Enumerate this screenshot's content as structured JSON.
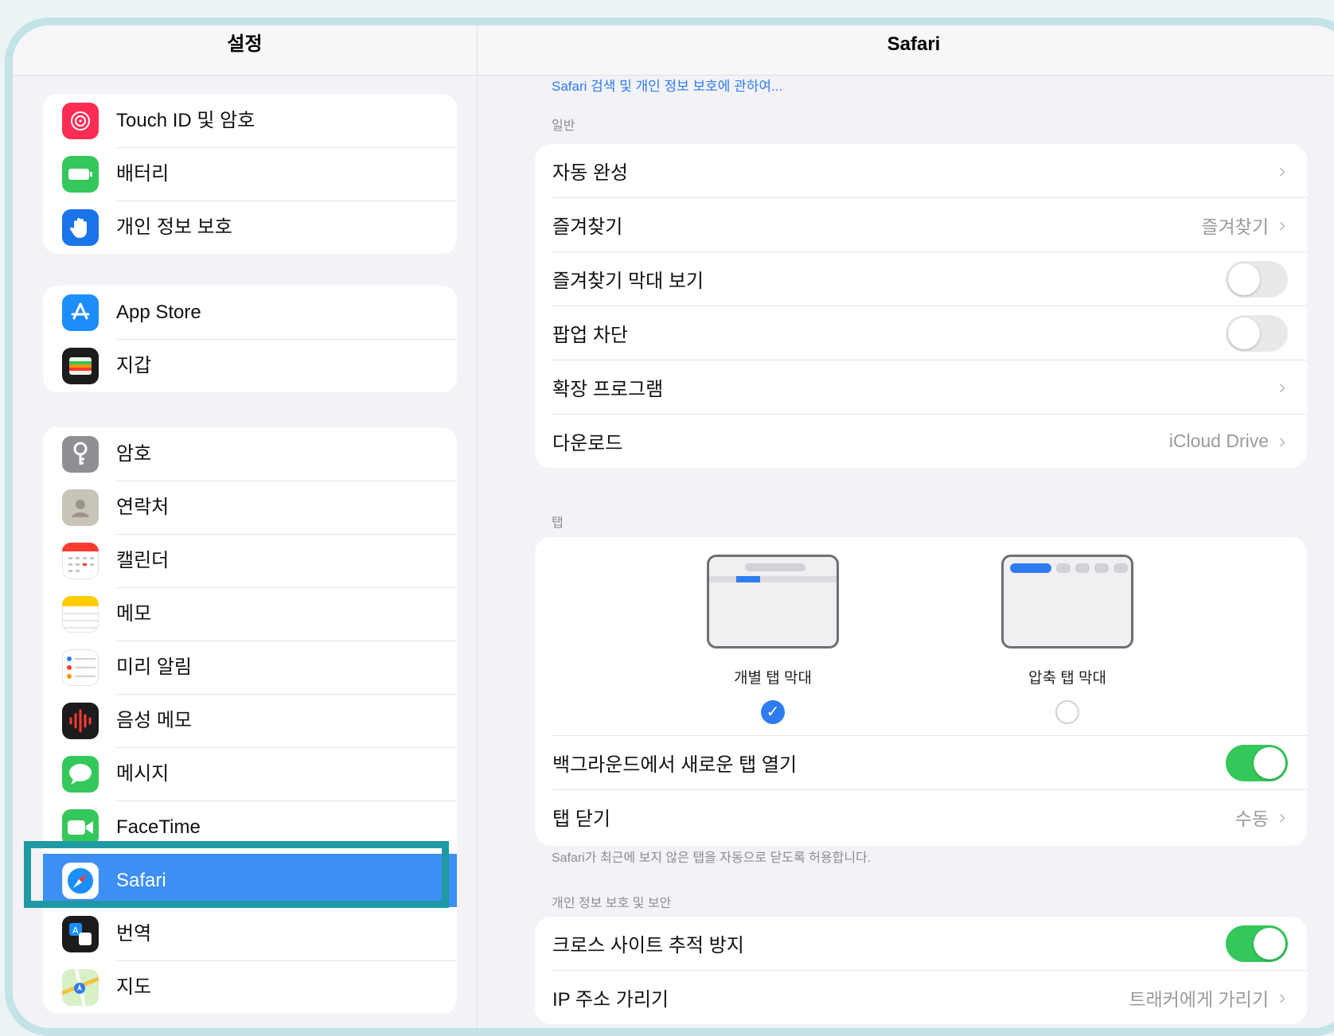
{
  "sidebar": {
    "title": "설정",
    "groups": [
      [
        {
          "label": "Touch ID 및 암호",
          "icon": "fingerprint-icon",
          "color": "#ff2d55"
        },
        {
          "label": "배터리",
          "icon": "battery-icon",
          "color": "#34c759"
        },
        {
          "label": "개인 정보 보호",
          "icon": "hand-icon",
          "color": "#1a73e8"
        }
      ],
      [
        {
          "label": "App Store",
          "icon": "app-store-icon",
          "color": "#1c8ef9"
        },
        {
          "label": "지갑",
          "icon": "wallet-icon",
          "color": "#1c1c1e"
        }
      ],
      [
        {
          "label": "암호",
          "icon": "key-icon",
          "color": "#8e8e93"
        },
        {
          "label": "연락처",
          "icon": "contacts-icon",
          "color": "#c8c4b8"
        },
        {
          "label": "캘린더",
          "icon": "calendar-icon",
          "color": "#ffffff"
        },
        {
          "label": "메모",
          "icon": "notes-icon",
          "color": "#ffffff"
        },
        {
          "label": "미리 알림",
          "icon": "reminders-icon",
          "color": "#ffffff"
        },
        {
          "label": "음성 메모",
          "icon": "voice-memo-icon",
          "color": "#1c1c1e"
        },
        {
          "label": "메시지",
          "icon": "messages-icon",
          "color": "#34c759"
        },
        {
          "label": "FaceTime",
          "icon": "facetime-icon",
          "color": "#34c759"
        },
        {
          "label": "Safari",
          "icon": "safari-icon",
          "color": "#ffffff",
          "selected": true
        },
        {
          "label": "번역",
          "icon": "translate-icon",
          "color": "#1c1c1e"
        },
        {
          "label": "지도",
          "icon": "maps-icon",
          "color": "#ffffff"
        }
      ]
    ]
  },
  "detail": {
    "title": "Safari",
    "link": "Safari 검색 및 개인 정보 보호에 관하여...",
    "general_header": "일반",
    "general_rows": [
      {
        "label": "자동 완성",
        "kind": "chevron",
        "value": ""
      },
      {
        "label": "즐겨찾기",
        "kind": "chevron",
        "value": "즐겨찾기"
      },
      {
        "label": "즐겨찾기 막대 보기",
        "kind": "toggle",
        "on": false
      },
      {
        "label": "팝업 차단",
        "kind": "toggle",
        "on": false
      },
      {
        "label": "확장 프로그램",
        "kind": "chevron",
        "value": ""
      },
      {
        "label": "다운로드",
        "kind": "chevron",
        "value": "iCloud Drive"
      }
    ],
    "tabs_header": "탭",
    "tab_options": [
      {
        "label": "개별 탭 막대",
        "selected": true
      },
      {
        "label": "압축 탭 막대",
        "selected": false
      }
    ],
    "tab_rows": [
      {
        "label": "백그라운드에서 새로운 탭 열기",
        "kind": "toggle",
        "on": true
      },
      {
        "label": "탭 닫기",
        "kind": "chevron",
        "value": "수동"
      }
    ],
    "tabs_footnote": "Safari가 최근에 보지 않은 탭을 자동으로 닫도록 허용합니다.",
    "privacy_header": "개인 정보 보호 및 보안",
    "privacy_rows": [
      {
        "label": "크로스 사이트 추적 방지",
        "kind": "toggle",
        "on": true
      },
      {
        "label": "IP 주소 가리기",
        "kind": "chevron",
        "value": "트래커에게 가리기"
      }
    ],
    "chevron_glyph": "›",
    "check_glyph": "✓"
  }
}
